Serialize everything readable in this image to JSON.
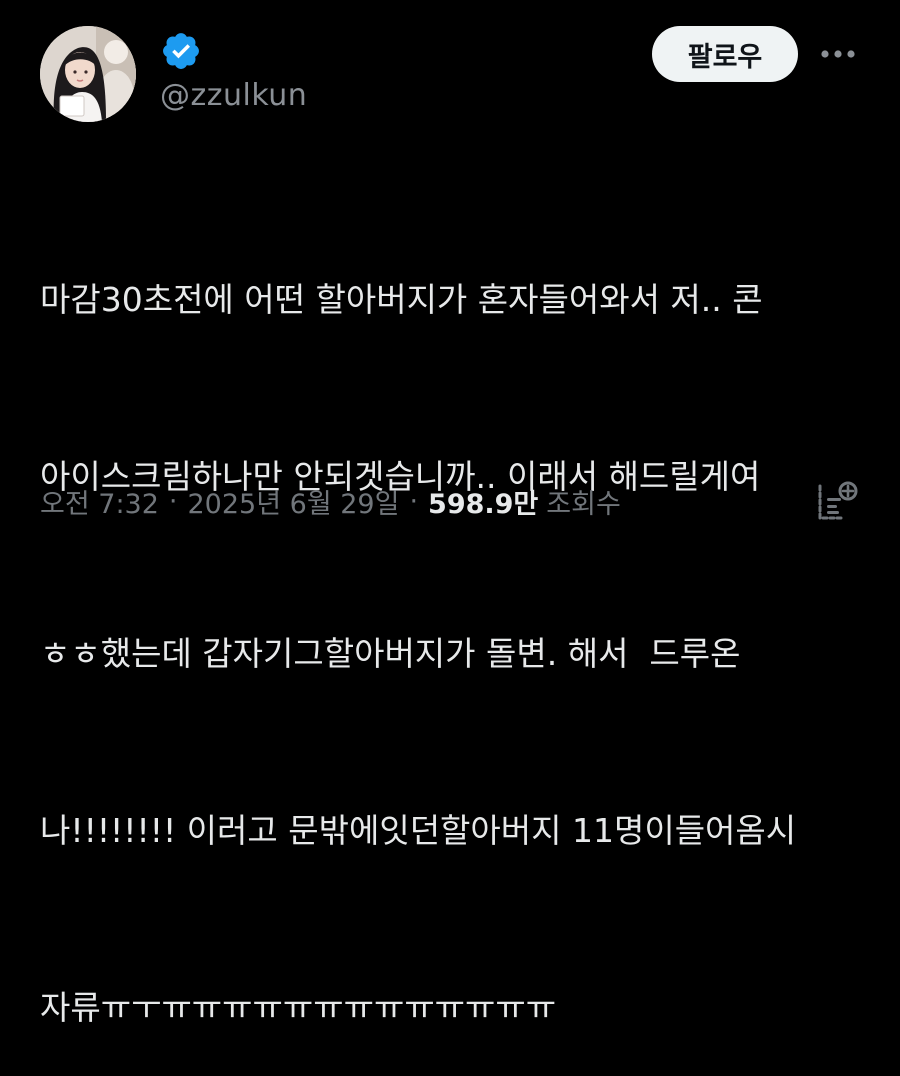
{
  "author": {
    "handle": "@zzulkun",
    "verified": true,
    "avatar_icon": "profile-photo"
  },
  "header": {
    "follow_label": "팔로우",
    "more_icon": "more-dots-icon"
  },
  "tweet": {
    "lines": [
      "마감30초전에 어떤 할아버지가 혼자들어와서 저.. 콘",
      "아이스크림하나만 안되겟습니까.. 이래서 해드릴게여",
      "ㅎㅎ했는데 갑자기그할아버지가 돌변. 해서  드루온",
      "나!!!!!!!! 이러고 문밖에잇던할아버지 11명이들어옴시",
      "자류ㅠㅜㅠㅠㅠㅠㅠㅠㅠㅠㅠㅠㅠㅠㅠ"
    ]
  },
  "meta": {
    "time": "오전 7:32",
    "separator": "·",
    "date": "2025년 6월 29일",
    "views_count": "598.9만",
    "views_label": "조회수"
  },
  "colors": {
    "background": "#000000",
    "text": "#e7e9ea",
    "secondary_text": "#71767b",
    "verified_badge": "#1d9bf0",
    "follow_button_bg": "#eff3f4"
  }
}
